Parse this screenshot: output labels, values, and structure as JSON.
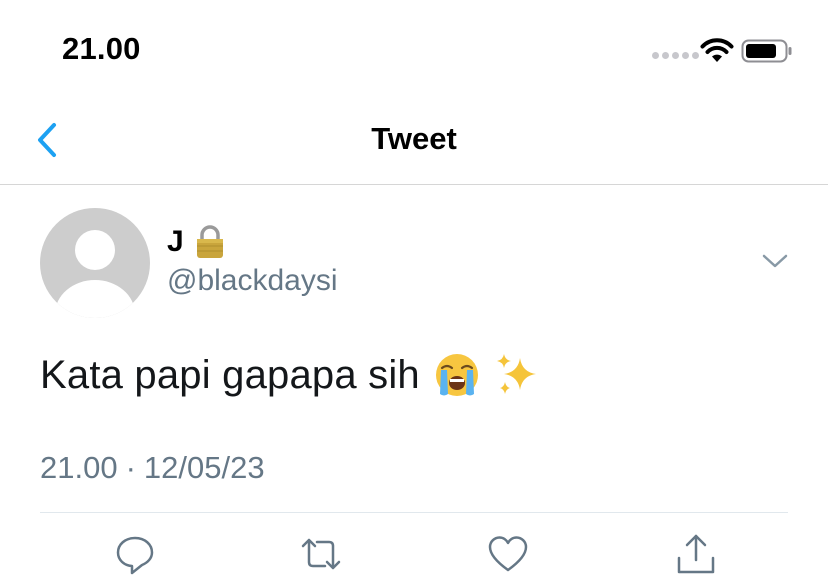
{
  "status_bar": {
    "time": "21.00"
  },
  "nav": {
    "title": "Tweet",
    "back_icon": "chevron-left-icon"
  },
  "tweet": {
    "display_name": "J",
    "handle": "@blackdaysi",
    "text": "Kata papi gapapa sih",
    "emojis": [
      "loudly-crying-face",
      "sparkles"
    ],
    "time": "21.00",
    "separator": "·",
    "date": "12/05/23"
  },
  "actions": [
    "reply-icon",
    "retweet-icon",
    "like-icon",
    "share-icon"
  ],
  "colors": {
    "accent": "#1da1f2",
    "secondary_text": "#657786",
    "avatar_placeholder": "#cdcdcd"
  }
}
